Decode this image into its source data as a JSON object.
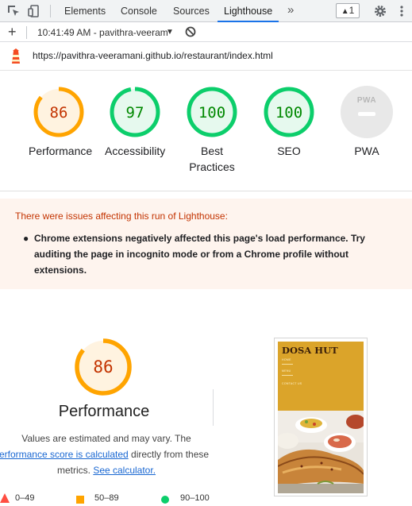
{
  "devtools": {
    "tabs": [
      {
        "label": "Elements"
      },
      {
        "label": "Console"
      },
      {
        "label": "Sources"
      },
      {
        "label": "Lighthouse"
      }
    ],
    "more_label": "»",
    "issues_count": "1",
    "active_tab": "Lighthouse"
  },
  "report_toolbar": {
    "add_label": "+",
    "report_selector": "10:41:49 AM - pavithra-veeram",
    "caret": "▼"
  },
  "url": "https://pavithra-veeramani.github.io/restaurant/index.html",
  "gauges": [
    {
      "name": "performance",
      "score": "86",
      "label": "Performance",
      "score_value": 86,
      "color": "#ffa400",
      "fill": "#fff3e0",
      "text_color": "#c33300"
    },
    {
      "name": "accessibility",
      "score": "97",
      "label": "Accessibility",
      "score_value": 97,
      "color": "#0cce6b",
      "fill": "#e6f9ee",
      "text_color": "#008800"
    },
    {
      "name": "best-practices",
      "score": "100",
      "label_line1": "Best",
      "label_line2": "Practices",
      "score_value": 100,
      "color": "#0cce6b",
      "fill": "#e6f9ee",
      "text_color": "#008800"
    },
    {
      "name": "seo",
      "score": "100",
      "label": "SEO",
      "score_value": 100,
      "color": "#0cce6b",
      "fill": "#e6f9ee",
      "text_color": "#008800"
    }
  ],
  "pwa": {
    "badge_text": "PWA",
    "label": "PWA"
  },
  "warning": {
    "title": "There were issues affecting this run of Lighthouse:",
    "items": [
      "Chrome extensions negatively affected this page's load performance. Try auditing the page in incognito mode or from a Chrome profile without extensions."
    ]
  },
  "performance_section": {
    "score": "86",
    "score_value": 86,
    "title": "Performance",
    "desc_line1": "Values are estimated and may vary. The",
    "desc_link1": "erformance score is calculated",
    "desc_after_link1": " directly from these",
    "desc_line3_prefix": "metrics. ",
    "desc_link2": "See calculator."
  },
  "legend": [
    {
      "range": "0–49",
      "color": "#ff4e42",
      "shape": "triangle"
    },
    {
      "range": "50–89",
      "color": "#ffa400",
      "shape": "square"
    },
    {
      "range": "90–100",
      "color": "#0cce6b",
      "shape": "circle"
    }
  ],
  "thumbnail": {
    "site_title": "DOSA HUT",
    "nav_items": [
      "HOME",
      "MENU",
      "CONTACT US"
    ]
  }
}
